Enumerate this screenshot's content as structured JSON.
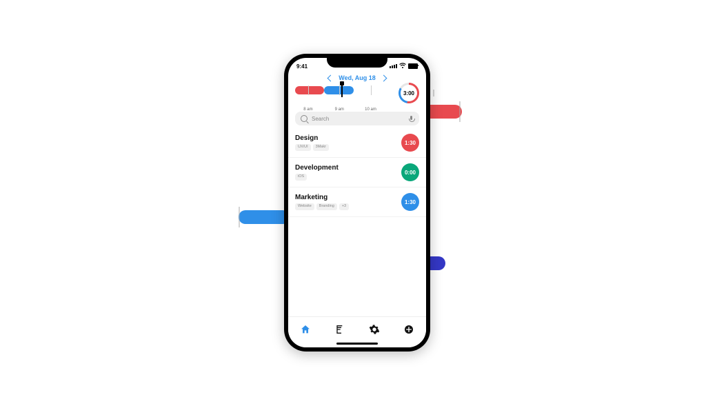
{
  "status": {
    "time": "9:41"
  },
  "date_nav": {
    "label": "Wed, Aug 18"
  },
  "timeline": {
    "labels": [
      "8 am",
      "9 am",
      "10 am"
    ],
    "total_label": "3:00"
  },
  "search": {
    "placeholder": "Search"
  },
  "projects": [
    {
      "title": "Design",
      "tags": [
        "UX/UI",
        "3Makr"
      ],
      "duration": "1:30",
      "color": "#e84a4f"
    },
    {
      "title": "Development",
      "tags": [
        "iOS"
      ],
      "duration": "0:00",
      "color": "#0aa77a"
    },
    {
      "title": "Marketing",
      "tags": [
        "Website",
        "Branding",
        "+3"
      ],
      "duration": "1:30",
      "color": "#2f8fe8"
    }
  ],
  "bg": {
    "red": "#e84a4f",
    "blue": "#2f8fe8",
    "navy": "#3437c5"
  }
}
